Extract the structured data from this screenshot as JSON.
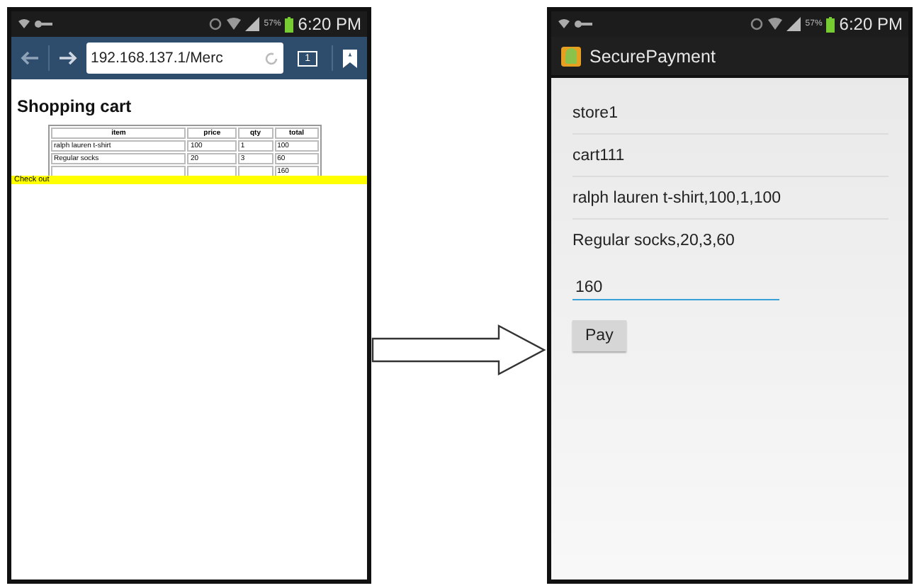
{
  "left_phone": {
    "status_bar": {
      "battery": "57%",
      "time": "6:20 PM"
    },
    "browser": {
      "url": "192.168.137.1/Merc",
      "tab_count": "1"
    },
    "page": {
      "heading": "Shopping cart",
      "table": {
        "columns": [
          "item",
          "price",
          "qty",
          "total"
        ],
        "rows": [
          {
            "item": "ralph lauren t-shirt",
            "price": "100",
            "qty": "1",
            "total": "100"
          },
          {
            "item": "Regular socks",
            "price": "20",
            "qty": "3",
            "total": "60"
          },
          {
            "total": "160"
          }
        ]
      },
      "checkout_link": "Check out"
    }
  },
  "right_phone": {
    "status_bar": {
      "battery": "57%",
      "time": "6:20 PM"
    },
    "app_title": "SecurePayment",
    "list_items": [
      "store1",
      "cart111",
      "ralph lauren t-shirt,100,1,100",
      "Regular socks,20,3,60"
    ],
    "amount_field": {
      "value": "160"
    },
    "pay_button": "Pay"
  }
}
